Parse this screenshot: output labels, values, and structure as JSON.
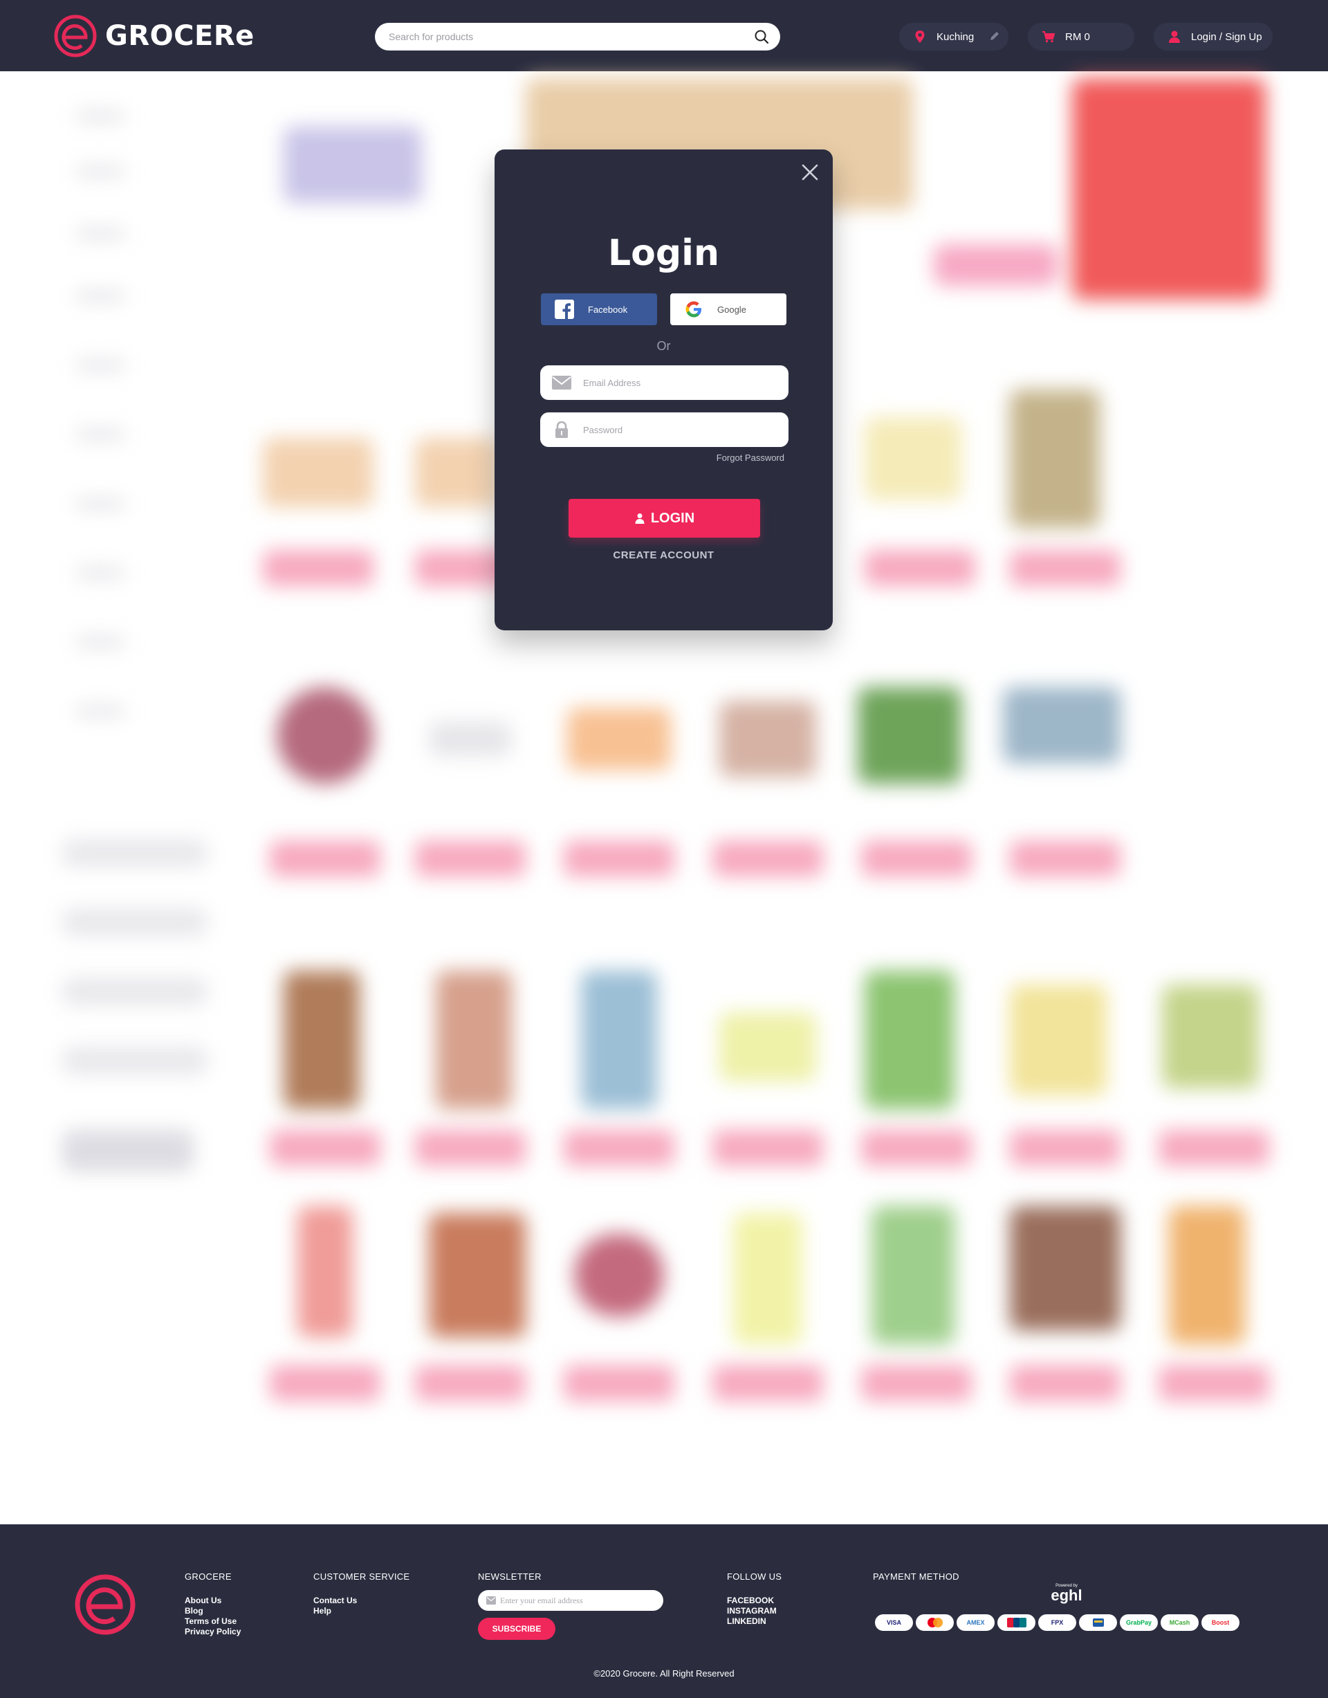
{
  "header": {
    "brand": "GROCERe",
    "search_placeholder": "Search for products",
    "location": "Kuching",
    "cart_total": "RM 0",
    "account_label": "Login / Sign Up"
  },
  "modal": {
    "title": "Login",
    "facebook_label": "Facebook",
    "google_label": "Google",
    "divider": "Or",
    "email_placeholder": "Email Address",
    "password_placeholder": "Password",
    "forgot_label": "Forgot Password",
    "login_label": "LOGIN",
    "create_label": "CREATE ACCOUNT"
  },
  "footer": {
    "grocere": {
      "heading": "GROCERE",
      "links": [
        "About Us",
        "Blog",
        "Terms of Use",
        "Privacy Policy"
      ]
    },
    "customer_service": {
      "heading": "CUSTOMER SERVICE",
      "links": [
        "Contact Us",
        "Help"
      ]
    },
    "newsletter": {
      "heading": "NEWSLETTER",
      "placeholder": "Enter your email address",
      "button": "SUBSCRIBE"
    },
    "follow": {
      "heading": "FOLLOW US",
      "links": [
        "FACEBOOK",
        "INSTAGRAM",
        "LINKEDIN"
      ]
    },
    "payment": {
      "heading": "PAYMENT METHOD",
      "powered_by": "Powered by",
      "gateway": "eghl",
      "methods": [
        "VISA",
        "Mastercard",
        "AMEX",
        "UnionPay",
        "FPX",
        "Bank",
        "GrabPay",
        "MCash",
        "Boost"
      ]
    },
    "copyright": "©2020 Grocere. All Right Reserved"
  },
  "colors": {
    "header_bg": "#2b2d3f",
    "accent": "#f0275a",
    "facebook": "#3b5998"
  }
}
